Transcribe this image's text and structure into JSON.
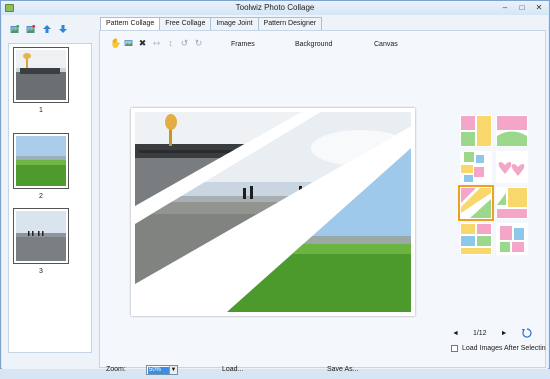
{
  "window": {
    "title": "Toolwiz Photo Collage"
  },
  "tabs": [
    "Pattern Collage",
    "Free Collage",
    "Image Joint",
    "Pattern Designer"
  ],
  "subtabs": {
    "frames": "Frames",
    "background": "Background",
    "canvas": "Canvas"
  },
  "thumbnails": [
    {
      "label": "1",
      "icon": "photo-pier-thumbnail"
    },
    {
      "label": "2",
      "icon": "photo-grass-field-thumbnail"
    },
    {
      "label": "3",
      "icon": "photo-beach-thumbnail"
    }
  ],
  "templates_pager": {
    "page": "1/12",
    "prev": "◄",
    "next": "►"
  },
  "load_after": {
    "label": "Load Images After Selectin",
    "checked": false
  },
  "bottom": {
    "zoom_label": "Zoom:",
    "zoom_value": "50%",
    "load_label": "Load...",
    "save_label": "Save As..."
  },
  "colors": {
    "accent": "#3b8ee0",
    "template_pink": "#f3a6c8",
    "template_yellow": "#f8d86a",
    "template_green": "#9bd88c",
    "template_blue": "#8dc7ea",
    "selection": "#f0a020"
  }
}
